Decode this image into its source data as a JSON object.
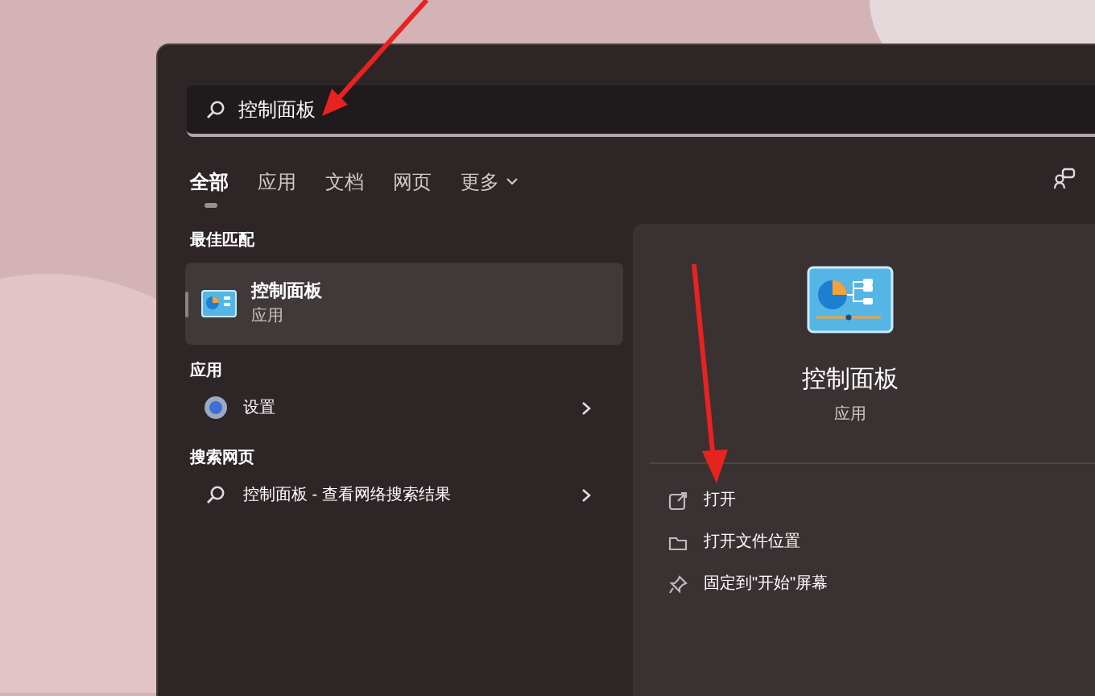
{
  "search": {
    "value": "控制面板"
  },
  "tabs": [
    {
      "label": "全部",
      "selected": true
    },
    {
      "label": "应用",
      "selected": false
    },
    {
      "label": "文档",
      "selected": false
    },
    {
      "label": "网页",
      "selected": false
    },
    {
      "label": "更多",
      "selected": false,
      "kind": "dropdown"
    }
  ],
  "best_match": {
    "heading": "最佳匹配",
    "title": "控制面板",
    "subtitle": "应用",
    "selected": true
  },
  "sections": [
    {
      "heading": "应用",
      "items": [
        {
          "kind": "settings",
          "label": "设置"
        }
      ]
    },
    {
      "heading": "搜索网页",
      "items": [
        {
          "kind": "web",
          "label": "控制面板",
          "suffix": " - 查看网络搜索结果"
        }
      ]
    }
  ],
  "detail": {
    "title": "控制面板",
    "subtitle": "应用",
    "actions": [
      {
        "kind": "open",
        "label": "打开"
      },
      {
        "kind": "folder",
        "label": "打开文件位置"
      },
      {
        "kind": "pin",
        "label": "固定到\"开始\"屏幕"
      }
    ]
  }
}
